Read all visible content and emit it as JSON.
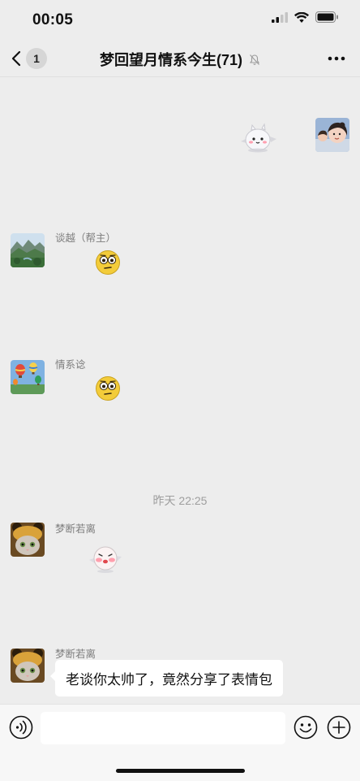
{
  "status_bar": {
    "time": "00:05",
    "icons": [
      "cellular-signal-icon",
      "wifi-icon",
      "battery-icon"
    ]
  },
  "nav": {
    "back_count": "1",
    "title": "梦回望月情系今生(71)",
    "icons": [
      "chevron-left-icon",
      "mute-bell-icon",
      "more-icon"
    ]
  },
  "messages": [
    {
      "type": "sticker",
      "side": "right",
      "sticker": "white-blob-sticker"
    },
    {
      "type": "sticker",
      "side": "left",
      "sender": "谈越（帮主）",
      "sticker": "rolling-eyes-emoji"
    },
    {
      "type": "sticker",
      "side": "left",
      "sender": "情系谂",
      "sticker": "rolling-eyes-emoji"
    },
    {
      "type": "timestamp",
      "text": "昨天 22:25"
    },
    {
      "type": "sticker",
      "side": "left",
      "sender": "梦断若离",
      "sticker": "shy-bun-sticker"
    },
    {
      "type": "text",
      "side": "left",
      "sender": "梦断若离",
      "text": "老谈你太帅了，竟然分享了表情包"
    }
  ],
  "input_bar": {
    "placeholder": "",
    "icons": [
      "voice-icon",
      "emoji-icon",
      "plus-icon"
    ]
  },
  "colors": {
    "background": "#ededed",
    "bubble": "#ffffff",
    "input_bar": "#f7f7f7",
    "name_text": "#7d7d7d"
  }
}
